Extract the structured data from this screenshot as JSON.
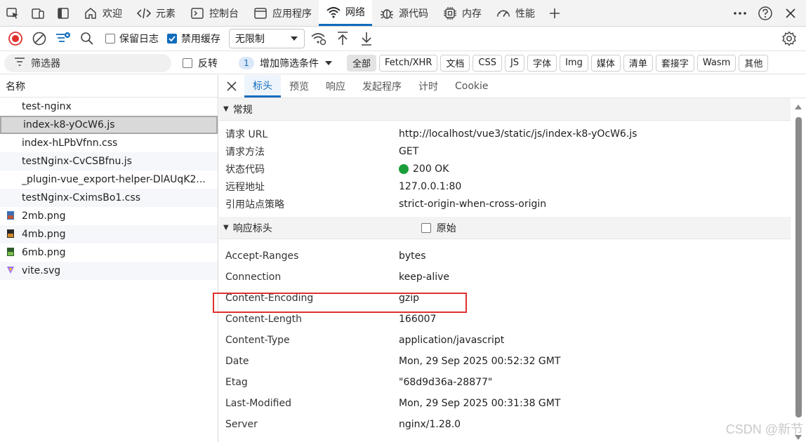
{
  "top_tabs": [
    {
      "label": "欢迎",
      "icon": "home-icon"
    },
    {
      "label": "元素",
      "icon": "code-icon"
    },
    {
      "label": "控制台",
      "icon": "console-icon"
    },
    {
      "label": "应用程序",
      "icon": "application-icon"
    },
    {
      "label": "网络",
      "icon": "wifi-icon",
      "active": true
    },
    {
      "label": "源代码",
      "icon": "bug-icon"
    },
    {
      "label": "内存",
      "icon": "memory-icon"
    },
    {
      "label": "性能",
      "icon": "gauge-icon"
    }
  ],
  "toolbar": {
    "preserve_log_label": "保留日志",
    "preserve_log_checked": false,
    "disable_cache_label": "禁用缓存",
    "disable_cache_checked": true,
    "throttle_value": "无限制"
  },
  "filter": {
    "placeholder": "筛选器",
    "invert_label": "反转",
    "invert_checked": false,
    "add_filter_count": "1",
    "add_filter_label": "增加筛选条件",
    "chips": [
      "全部",
      "Fetch/XHR",
      "文档",
      "CSS",
      "JS",
      "字体",
      "Img",
      "媒体",
      "清单",
      "套接字",
      "Wasm",
      "其他"
    ],
    "active_chip": "全部"
  },
  "request_list": {
    "header": "名称",
    "items": [
      {
        "name": "test-nginx",
        "type": "doc"
      },
      {
        "name": "index-k8-yOcW6.js",
        "type": "js",
        "selected": true
      },
      {
        "name": "index-hLPbVfnn.css",
        "type": "css"
      },
      {
        "name": "testNginx-CvCSBfnu.js",
        "type": "js"
      },
      {
        "name": "_plugin-vue_export-helper-DlAUqK2...",
        "type": "js"
      },
      {
        "name": "testNginx-CximsBo1.css",
        "type": "css"
      },
      {
        "name": "2mb.png",
        "type": "image"
      },
      {
        "name": "4mb.png",
        "type": "image"
      },
      {
        "name": "6mb.png",
        "type": "image"
      },
      {
        "name": "vite.svg",
        "type": "svg"
      }
    ]
  },
  "detail_tabs": [
    "标头",
    "预览",
    "响应",
    "发起程序",
    "计时",
    "Cookie"
  ],
  "general": {
    "title": "常规",
    "rows": [
      {
        "k": "请求 URL",
        "v": "http://localhost/vue3/static/js/index-k8-yOcW6.js"
      },
      {
        "k": "请求方法",
        "v": "GET"
      },
      {
        "k": "状态代码",
        "v": "200 OK"
      },
      {
        "k": "远程地址",
        "v": "127.0.0.1:80"
      },
      {
        "k": "引用站点策略",
        "v": "strict-origin-when-cross-origin"
      }
    ]
  },
  "response_headers": {
    "title": "响应标头",
    "raw_label": "原始",
    "raw_checked": false,
    "rows": [
      {
        "k": "Accept-Ranges",
        "v": "bytes"
      },
      {
        "k": "Connection",
        "v": "keep-alive"
      },
      {
        "k": "Content-Encoding",
        "v": "gzip"
      },
      {
        "k": "Content-Length",
        "v": "166007"
      },
      {
        "k": "Content-Type",
        "v": "application/javascript"
      },
      {
        "k": "Date",
        "v": "Mon, 29 Sep 2025 00:52:32 GMT"
      },
      {
        "k": "Etag",
        "v": "\"68d9d36a-28877\""
      },
      {
        "k": "Last-Modified",
        "v": "Mon, 29 Sep 2025 00:31:38 GMT"
      },
      {
        "k": "Server",
        "v": "nginx/1.28.0"
      }
    ]
  },
  "colors": {
    "accent": "#0f6cbd",
    "record": "#e0312e",
    "status_ok": "#1a9e3a",
    "highlight_box": "#e0312e"
  },
  "watermark": "CSDN @新节"
}
